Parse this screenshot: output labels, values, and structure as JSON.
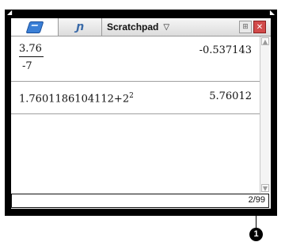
{
  "tabs": [
    {
      "icon": "calculator-icon",
      "active": true
    },
    {
      "icon": "graph-icon",
      "active": false
    },
    {
      "label": "Scratchpad",
      "active": false
    }
  ],
  "graph_icon_glyph": "ɲ",
  "window_controls": {
    "doc_glyph": "⊞",
    "close_glyph": "✕"
  },
  "caret_glyph": "▽",
  "history": [
    {
      "numerator": "3.76",
      "denominator": "-7",
      "result": "-0.537143"
    },
    {
      "expression_base": "1.7601186104112+2",
      "exponent": "2",
      "result": "5.76012"
    }
  ],
  "scroll": {
    "up_glyph": "▲",
    "down_glyph": "▼"
  },
  "entry_line": {
    "page_count": "2/99"
  },
  "callout": {
    "number": "1"
  },
  "colors": {
    "accent": "#3a7fd6",
    "close": "#d24a4a"
  }
}
